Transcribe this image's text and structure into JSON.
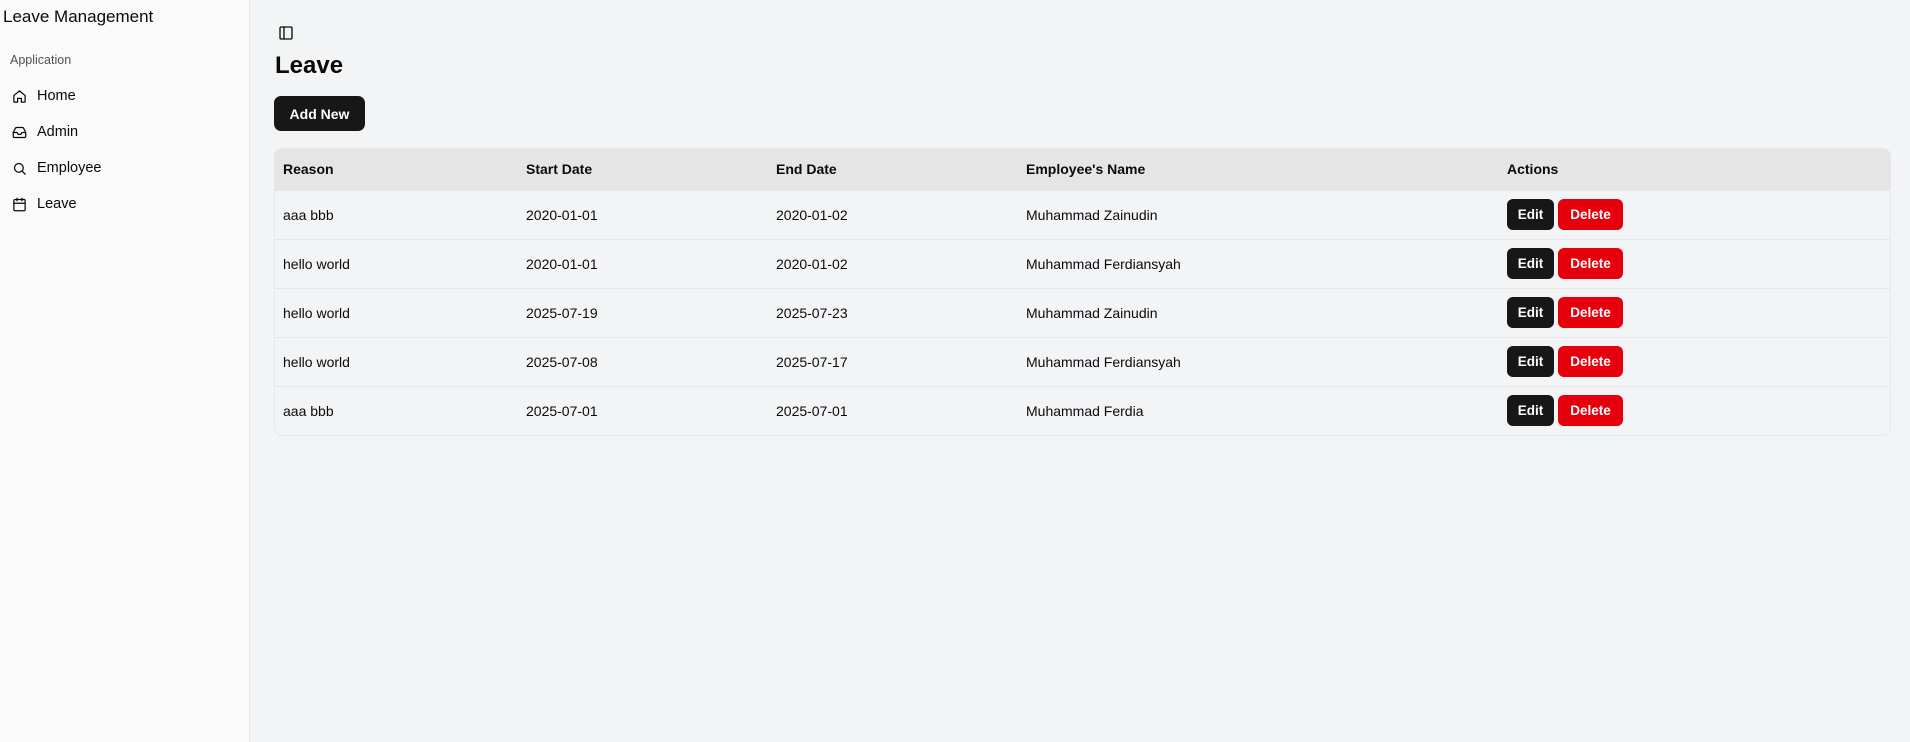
{
  "app": {
    "title": "Leave Management"
  },
  "sidebar": {
    "group_label": "Application",
    "items": [
      {
        "label": "Home",
        "icon": "home-icon"
      },
      {
        "label": "Admin",
        "icon": "inbox-icon"
      },
      {
        "label": "Employee",
        "icon": "search-icon"
      },
      {
        "label": "Leave",
        "icon": "calendar-icon"
      }
    ]
  },
  "header": {
    "toggle_icon": "panel-left-icon"
  },
  "page": {
    "title": "Leave",
    "add_button_label": "Add New"
  },
  "table": {
    "columns": [
      "Reason",
      "Start Date",
      "End Date",
      "Employee's Name",
      "Actions"
    ],
    "rows": [
      {
        "reason": "aaa bbb",
        "start_date": "2020-01-01",
        "end_date": "2020-01-02",
        "employee_name": "Muhammad Zainudin"
      },
      {
        "reason": "hello world",
        "start_date": "2020-01-01",
        "end_date": "2020-01-02",
        "employee_name": "Muhammad Ferdiansyah"
      },
      {
        "reason": "hello world",
        "start_date": "2025-07-19",
        "end_date": "2025-07-23",
        "employee_name": "Muhammad Zainudin"
      },
      {
        "reason": "hello world",
        "start_date": "2025-07-08",
        "end_date": "2025-07-17",
        "employee_name": "Muhammad Ferdiansyah"
      },
      {
        "reason": "aaa bbb",
        "start_date": "2025-07-01",
        "end_date": "2025-07-01",
        "employee_name": "Muhammad Ferdia"
      }
    ],
    "edit_label": "Edit",
    "delete_label": "Delete"
  },
  "colors": {
    "primary_button": "#171717",
    "danger_button": "#e7000b",
    "background": "#f3f4f6",
    "sidebar_background": "#fafafa",
    "table_header": "#e5e5e5"
  }
}
